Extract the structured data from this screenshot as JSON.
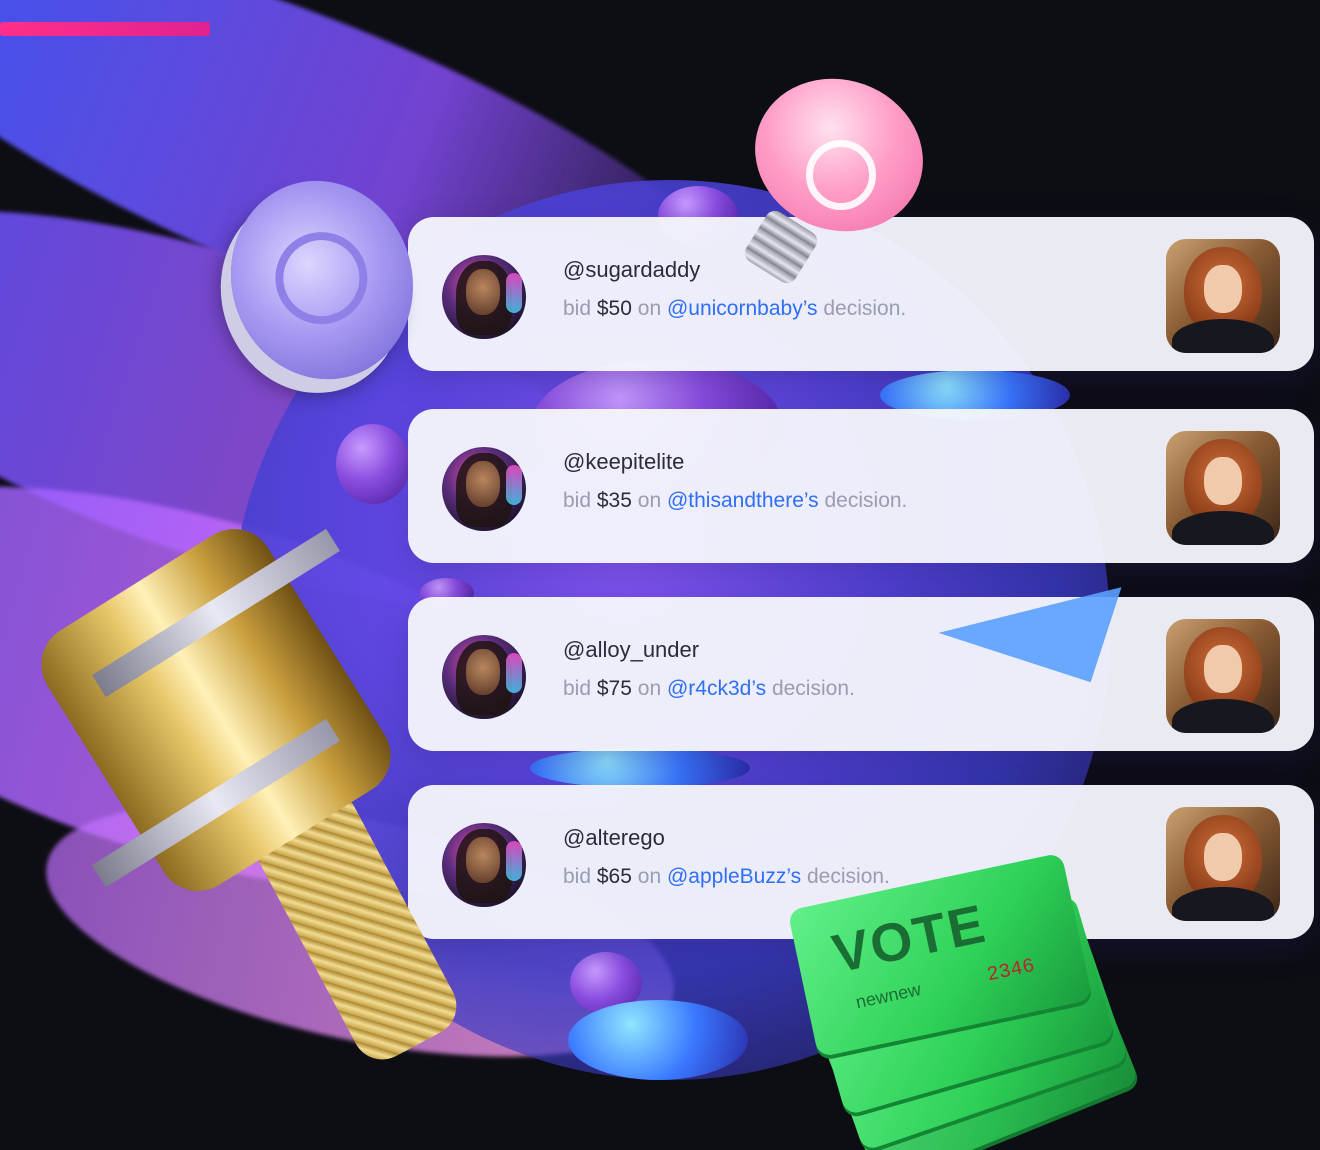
{
  "activity": [
    {
      "username": "@sugardaddy",
      "prefix": "bid",
      "amount": "$50",
      "connector": "on",
      "target": "@unicornbaby’s",
      "suffix": "decision."
    },
    {
      "username": "@keepitelite",
      "prefix": "bid",
      "amount": "$35",
      "connector": "on",
      "target": "@thisandthere’s",
      "suffix": "decision."
    },
    {
      "username": "@alloy_under",
      "prefix": "bid",
      "amount": "$75",
      "connector": "on",
      "target": "@r4ck3d’s",
      "suffix": "decision."
    },
    {
      "username": "@alterego",
      "prefix": "bid",
      "amount": "$65",
      "connector": "on",
      "target": "@appleBuzz’s",
      "suffix": "decision."
    }
  ],
  "ticket": {
    "label": "VOTE",
    "brand": "newnew",
    "number": "2346"
  },
  "colors": {
    "mention": "#2f6ff5",
    "card_bg": "#f4f5fc",
    "text_primary": "#2b2b3a",
    "text_muted": "#9a9cb2",
    "ticket_green": "#2ed158",
    "accent_pink": "#ff2f8a"
  },
  "icons": {
    "coin": "coin-icon",
    "bulb": "lightbulb-icon",
    "plane": "paper-plane-icon",
    "gavel": "gavel-icon",
    "ticket": "vote-ticket-icon"
  }
}
